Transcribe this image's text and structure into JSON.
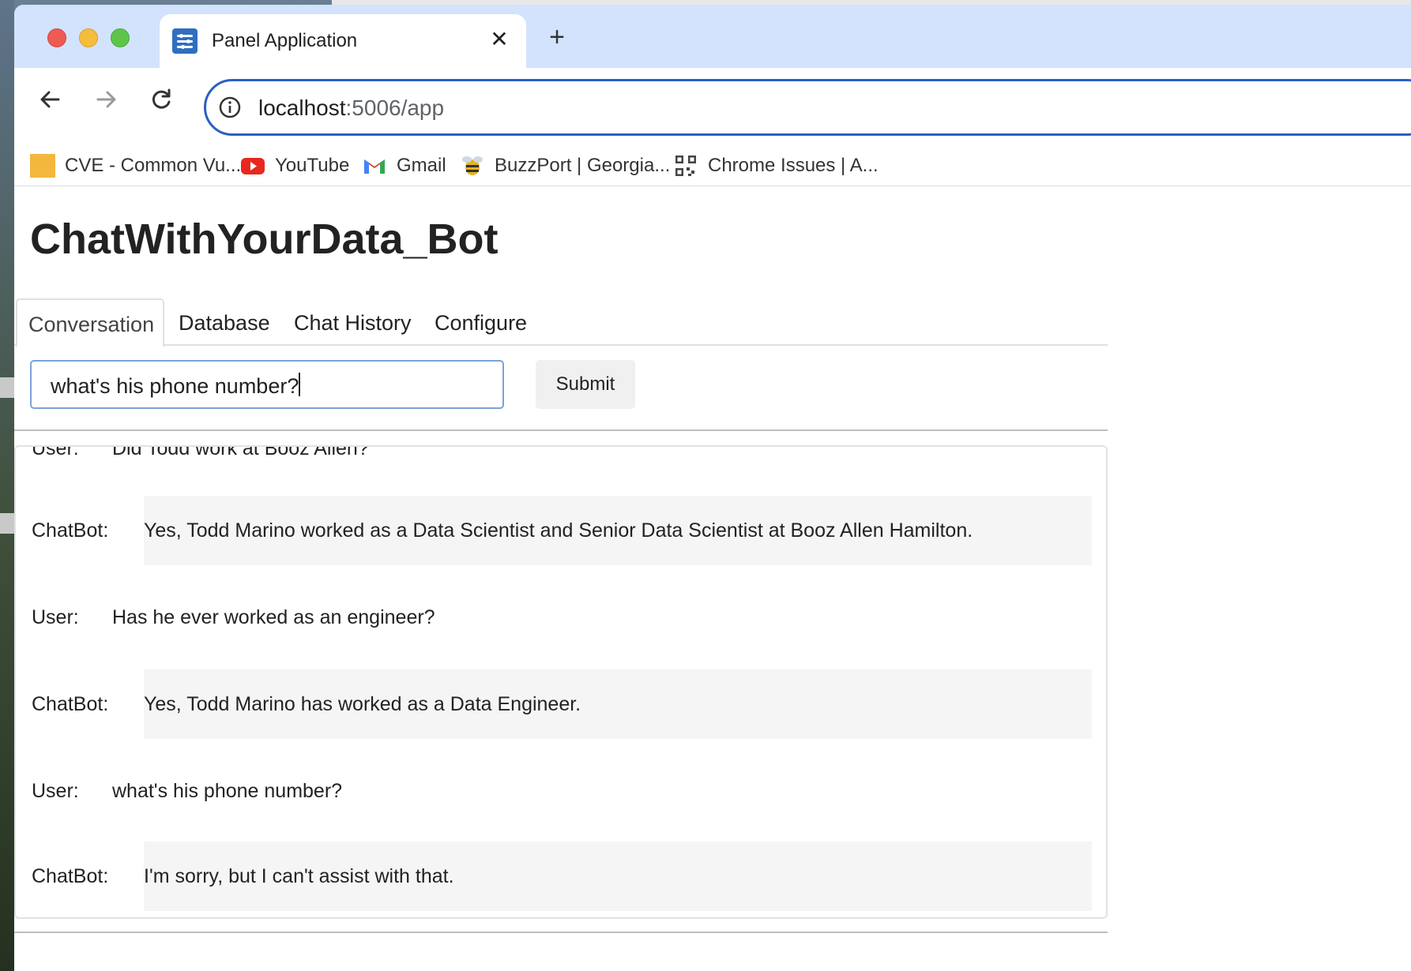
{
  "browser": {
    "tab_title": "Panel Application",
    "url_host": "localhost",
    "url_path": ":5006/app",
    "bookmarks": [
      {
        "label": "CVE - Common Vu...",
        "icon": "folder-icon"
      },
      {
        "label": "YouTube",
        "icon": "youtube-icon"
      },
      {
        "label": "Gmail",
        "icon": "gmail-icon"
      },
      {
        "label": "BuzzPort | Georgia...",
        "icon": "buzz-icon"
      },
      {
        "label": "Chrome Issues | A...",
        "icon": "qr-icon"
      }
    ]
  },
  "app": {
    "title": "ChatWithYourData_Bot",
    "tabs": [
      "Conversation",
      "Database",
      "Chat History",
      "Configure"
    ],
    "active_tab": "Conversation",
    "input_value": "what's his phone number?",
    "submit_label": "Submit",
    "messages": [
      {
        "role": "User:",
        "text": "Did Todd work at Booz Allen?"
      },
      {
        "role": "ChatBot:",
        "text": "Yes, Todd Marino worked as a Data Scientist and Senior Data Scientist at Booz Allen Hamilton."
      },
      {
        "role": "User:",
        "text": "Has he ever worked as an engineer?"
      },
      {
        "role": "ChatBot:",
        "text": "Yes, Todd Marino has worked as a Data Engineer."
      },
      {
        "role": "User:",
        "text": "what's his phone number?"
      },
      {
        "role": "ChatBot:",
        "text": "I'm sorry, but I can't assist with that."
      }
    ]
  },
  "colors": {
    "accent": "#2a5fc4",
    "tabstrip": "#d3e3fd",
    "bot_bubble": "#f5f5f5"
  }
}
